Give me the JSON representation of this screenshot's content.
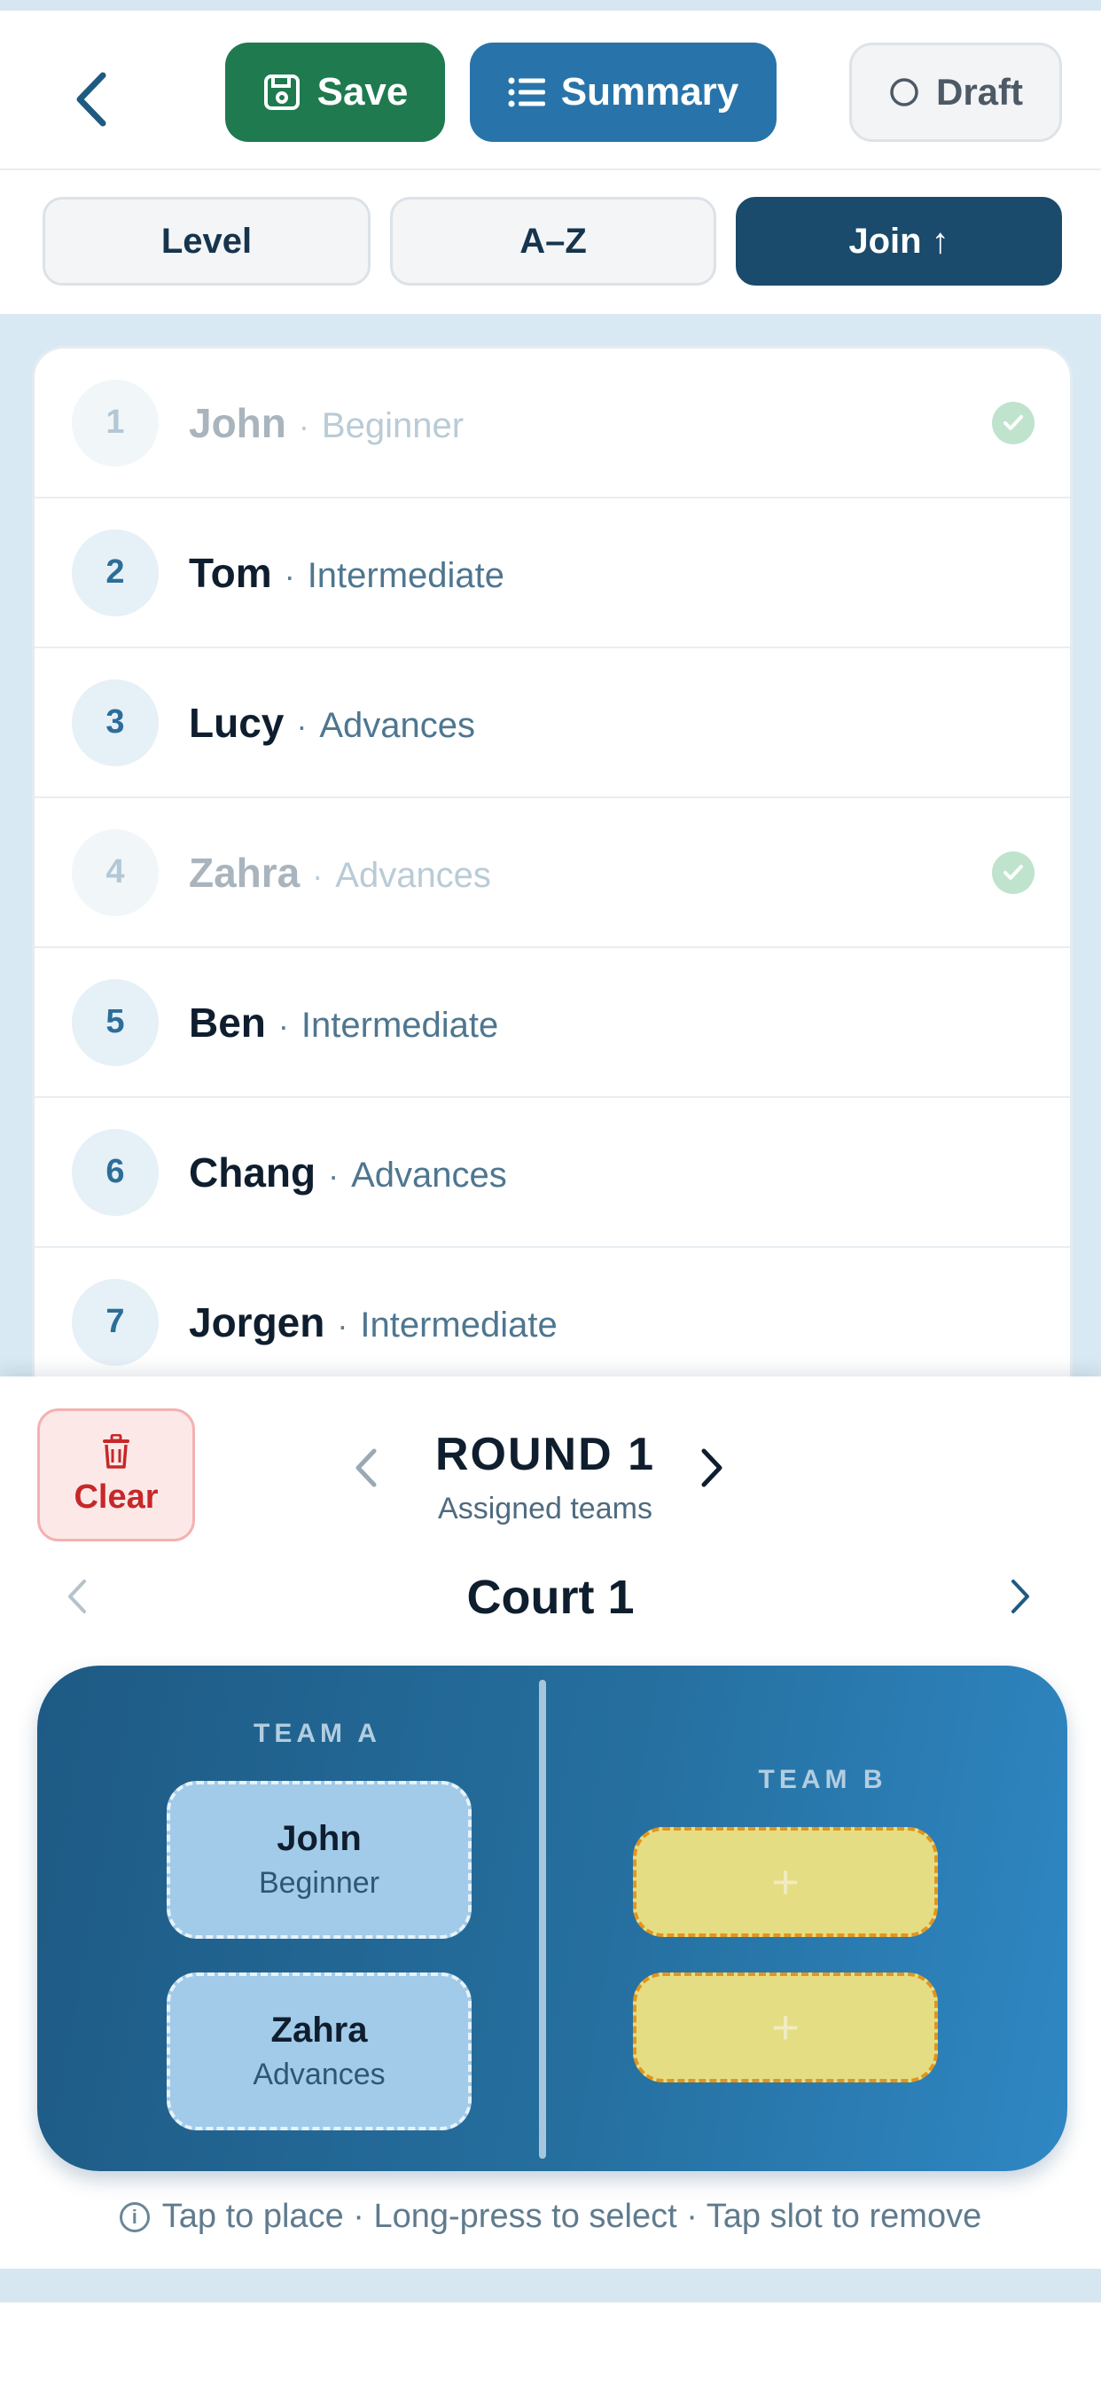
{
  "header": {
    "save_label": "Save",
    "summary_label": "Summary",
    "draft_label": "Draft"
  },
  "sort": {
    "level_label": "Level",
    "az_label": "A–Z",
    "join_label": "Join ↑"
  },
  "players": [
    {
      "num": "1",
      "name": "John",
      "level": "Beginner",
      "assigned": true
    },
    {
      "num": "2",
      "name": "Tom",
      "level": "Intermediate",
      "assigned": false
    },
    {
      "num": "3",
      "name": "Lucy",
      "level": "Advances",
      "assigned": false
    },
    {
      "num": "4",
      "name": "Zahra",
      "level": "Advances",
      "assigned": true
    },
    {
      "num": "5",
      "name": "Ben",
      "level": "Intermediate",
      "assigned": false
    },
    {
      "num": "6",
      "name": "Chang",
      "level": "Advances",
      "assigned": false
    },
    {
      "num": "7",
      "name": "Jorgen",
      "level": "Intermediate",
      "assigned": false
    }
  ],
  "panel": {
    "clear_label": "Clear",
    "round_title": "ROUND 1",
    "round_subtitle": "Assigned teams",
    "court_title": "Court 1",
    "team_a_label": "TEAM A",
    "team_b_label": "TEAM B",
    "team_a": [
      {
        "name": "John",
        "level": "Beginner"
      },
      {
        "name": "Zahra",
        "level": "Advances"
      }
    ],
    "empty_slot": "+",
    "hint": "Tap to place · Long-press to select · Tap slot to remove",
    "hint_icon": "i"
  },
  "colors": {
    "save": "#1f7a50",
    "summary": "#2874aa",
    "join_active": "#1a4a6c",
    "clear": "#c62828",
    "empty_slot": "#e5dd83"
  }
}
